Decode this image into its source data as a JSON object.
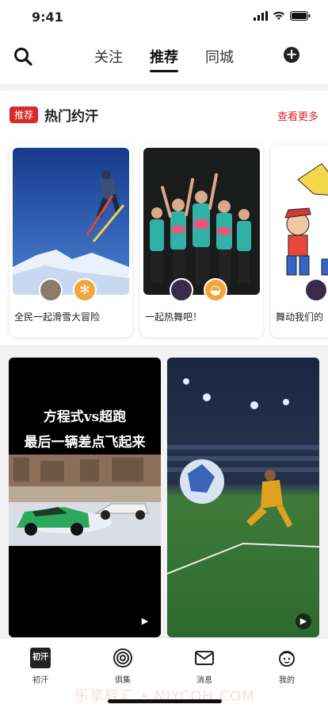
{
  "status": {
    "time": "9:41"
  },
  "nav": {
    "tabs": [
      {
        "label": "关注"
      },
      {
        "label": "推荐"
      },
      {
        "label": "同城"
      }
    ],
    "active_tab": "推荐"
  },
  "hot": {
    "badge": "推荐",
    "title": "热门约汗",
    "see_more": "查看更多",
    "cards": [
      {
        "title": "全民一起滑雪大冒险"
      },
      {
        "title": "一起热舞吧！"
      },
      {
        "title": "舞动我们的"
      }
    ]
  },
  "videos": [
    {
      "line1": "方程式vs超跑",
      "line2": "最后一辆差点飞起来"
    },
    {
      "line1": "",
      "line2": ""
    }
  ],
  "tabbar": {
    "items": [
      {
        "label": "初汗",
        "logo": "初汗"
      },
      {
        "label": "俱集"
      },
      {
        "label": "消息"
      },
      {
        "label": "我的"
      }
    ]
  },
  "watermark": "乐享轻汇 • NJYCOH.COM",
  "colors": {
    "accent": "#d52b2b",
    "orange": "#f3a43b"
  }
}
